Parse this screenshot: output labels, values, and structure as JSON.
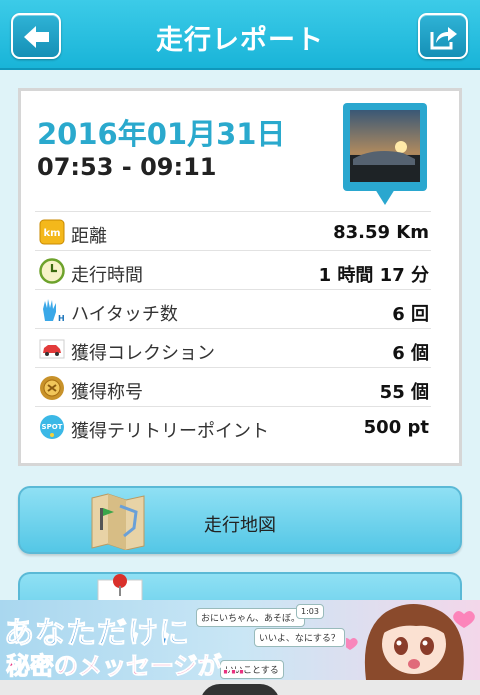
{
  "header": {
    "title": "走行レポート"
  },
  "report": {
    "date": "2016年01月31日",
    "time_range": "07:53 - 09:11"
  },
  "stats": [
    {
      "icon": "km-icon",
      "label": "距離",
      "value": "83.59 Km"
    },
    {
      "icon": "clock-icon",
      "label": "走行時間",
      "value": "1 時間 17 分"
    },
    {
      "icon": "hi-five-icon",
      "label": "ハイタッチ数",
      "value": "6 回"
    },
    {
      "icon": "car-icon",
      "label": "獲得コレクション",
      "value": "6 個"
    },
    {
      "icon": "medal-icon",
      "label": "獲得称号",
      "value": "55 個"
    },
    {
      "icon": "spot-icon",
      "label": "獲得テリトリーポイント",
      "value": "500 pt"
    }
  ],
  "buttons": {
    "map_label": "走行地図"
  },
  "ad": {
    "line1": "あなただけに",
    "line2": "秘密のメッセージが…",
    "bubbles": [
      "おにいちゃん、あそぼ。",
      "いいよ、なにする？",
      "いいことする"
    ],
    "badge": "1:03"
  },
  "colors": {
    "accent": "#2aa9cd",
    "header": "#19b4d8"
  }
}
